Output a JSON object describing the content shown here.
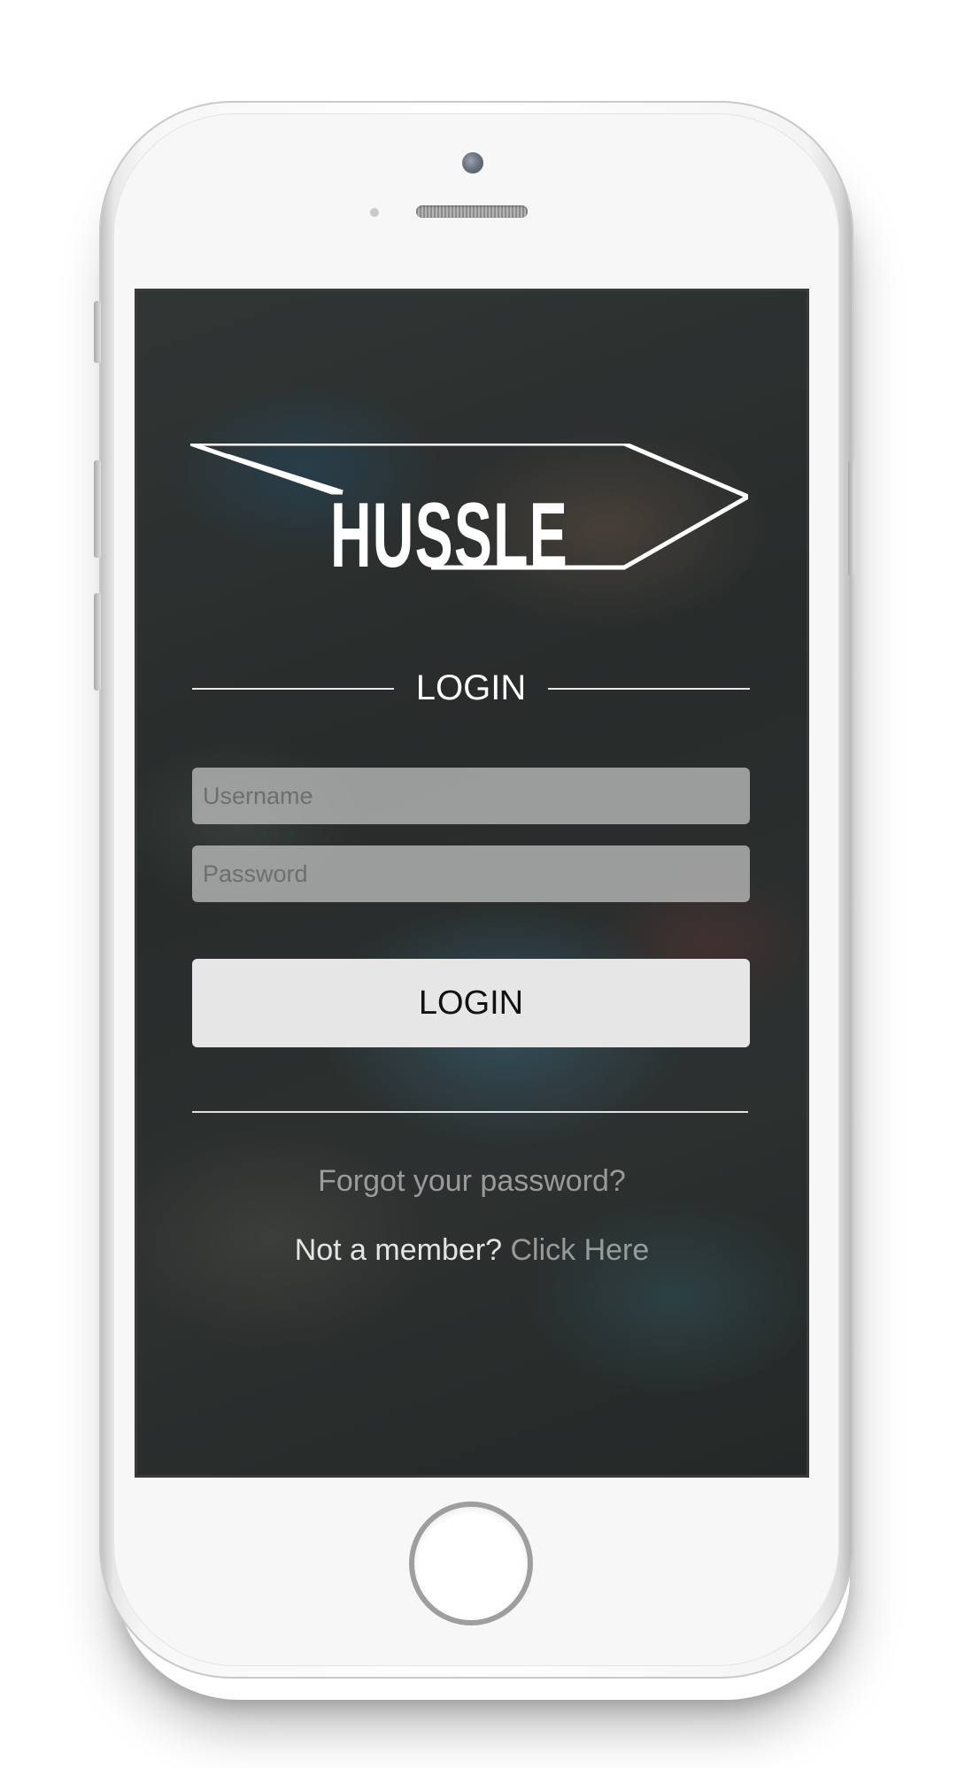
{
  "app": {
    "brand_name": "HUSSLE"
  },
  "login": {
    "heading": "LOGIN",
    "username_placeholder": "Username",
    "password_placeholder": "Password",
    "button_label": "LOGIN",
    "forgot_password_link": "Forgot your password?",
    "not_member_text": "Not a member?",
    "signup_link": "Click Here"
  },
  "colors": {
    "text_primary": "#ffffff",
    "field_background": "#c8c8c8",
    "button_background": "#e6e6e6",
    "link_muted": "#c8c8c8"
  }
}
